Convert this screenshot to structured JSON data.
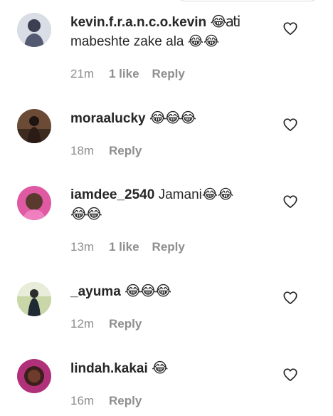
{
  "comments": [
    {
      "username": "kevin.f.r.a.n.c.o.kevin",
      "text_line1": "😂ati",
      "text_line2": "mabeshte zake ala 😂😂",
      "time": "21m",
      "likes": "1 like",
      "reply": "Reply"
    },
    {
      "username": "moraalucky",
      "text_line1": "😂😂😂",
      "time": "18m",
      "reply": "Reply"
    },
    {
      "username": "iamdee_2540",
      "text_line1": "Jamani😂😂",
      "text_line2": "😂😂",
      "time": "13m",
      "likes": "1 like",
      "reply": "Reply"
    },
    {
      "username": "_ayuma",
      "text_line1": "😂😂😂",
      "time": "12m",
      "reply": "Reply"
    },
    {
      "username": "lindah.kakai",
      "text_line1": "😂",
      "time": "16m",
      "reply": "Reply"
    }
  ],
  "icons": {
    "like": "heart-outline-icon"
  },
  "colors": {
    "text": "#262626",
    "meta": "#8e8e8e",
    "icon": "#262626"
  }
}
